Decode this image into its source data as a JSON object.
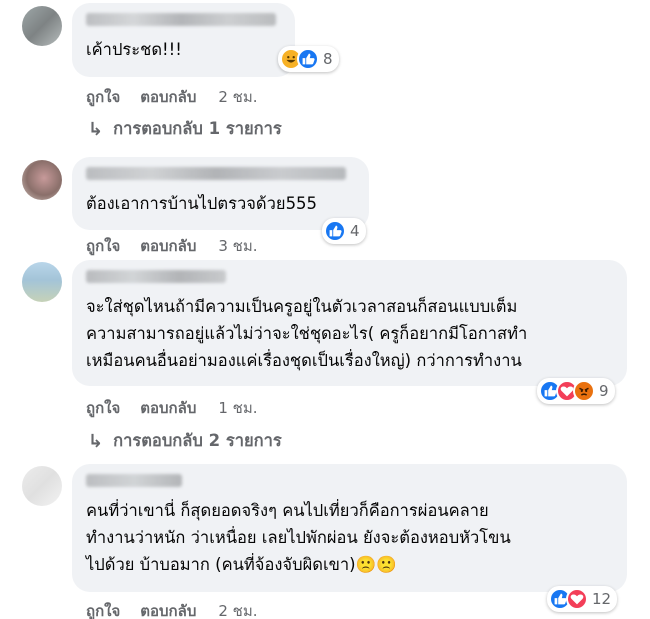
{
  "comments": [
    {
      "text": "เค้าประชด!!!",
      "reaction_count": "8",
      "reactions": [
        "haha",
        "like"
      ],
      "like_label": "ถูกใจ",
      "reply_label": "ตอบกลับ",
      "time": "2 ชม.",
      "replies_label": "การตอบกลับ 1 รายการ"
    },
    {
      "text": "ต้องเอาการบ้านไปตรวจด้วย555",
      "reaction_count": "4",
      "reactions": [
        "like"
      ],
      "like_label": "ถูกใจ",
      "reply_label": "ตอบกลับ",
      "time": "3 ชม."
    },
    {
      "text": "จะใส่ชุดไหนถ้ามีความเป็นครูอยู่ในตัวเวลาสอนก็สอนแบบเต็ม\nความสามารถอยู่แล้วไม่ว่าจะใช่ชุดอะไร( ครูก็อยากมีโอกาสทำ\nเหมือนคนอื่นอย่ามองแค่เรื่องชุดเป็นเรื่องใหญ่) กว่าการทำงาน",
      "reaction_count": "9",
      "reactions": [
        "like",
        "love",
        "angry"
      ],
      "like_label": "ถูกใจ",
      "reply_label": "ตอบกลับ",
      "time": "1 ชม.",
      "replies_label": "การตอบกลับ 2 รายการ"
    },
    {
      "text": "คนที่ว่าเขานี่ ก็สุดยอดจริงๆ คนไปเที่ยวก็คือการผ่อนคลาย\nทำงานว่าหนัก ว่าเหนื่อย เลยไปพักผ่อน ยังจะต้องหอบหัวโขน\nไปด้วย บ้าบอมาก (คนที่จ้องจับผิดเขา)🙁🙁",
      "reaction_count": "12",
      "reactions": [
        "like",
        "love"
      ],
      "like_label": "ถูกใจ",
      "reply_label": "ตอบกลับ",
      "time": "2 ชม."
    }
  ],
  "colors": {
    "like": "#1877f2",
    "love": "#f33e58",
    "haha": "#f7b125",
    "angry": "#e9710f",
    "bubble": "#f0f2f5",
    "meta": "#65676b"
  }
}
